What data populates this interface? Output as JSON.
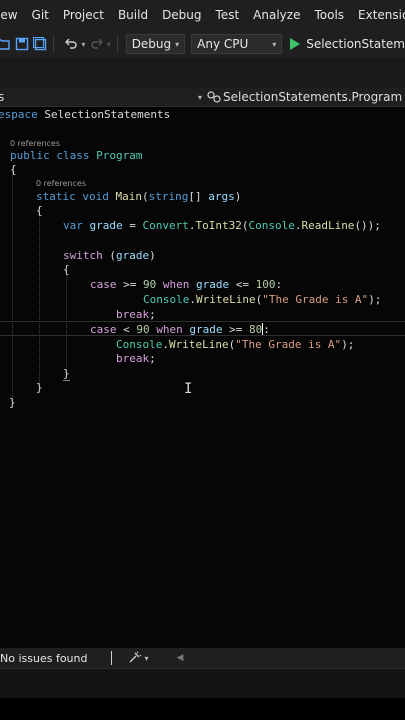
{
  "menu": [
    "iew",
    "Git",
    "Project",
    "Build",
    "Debug",
    "Test",
    "Analyze",
    "Tools",
    "Extensions"
  ],
  "toolbar": {
    "config": "Debug",
    "platform": "Any CPU",
    "run_target": "SelectionStatem"
  },
  "navbar": {
    "left": "s",
    "right": "SelectionStatements.Program"
  },
  "code": {
    "ns_kw": "espace",
    "ns_name": "SelectionStatements",
    "refs_class": "0 references",
    "class_line_kw1": "public",
    "class_line_kw2": "class",
    "class_name": "Program",
    "refs_main": "0 references",
    "main_static": "static",
    "main_void": "void",
    "main_name": "Main",
    "main_string": "string",
    "main_args": "args",
    "var_kw": "var",
    "var_name": "grade",
    "convert": "Convert",
    "toint": "ToInt32",
    "console": "Console",
    "readline": "ReadLine",
    "switch_kw": "switch",
    "case_kw": "case",
    "when_kw": "when",
    "n90": "90",
    "n100": "100",
    "n80": "80",
    "writeline": "WriteLine",
    "msg1": "\"The Grade is A\"",
    "msg2": "\"The Grade is A\"",
    "break_kw": "break"
  },
  "status": {
    "issues": "No issues found"
  }
}
